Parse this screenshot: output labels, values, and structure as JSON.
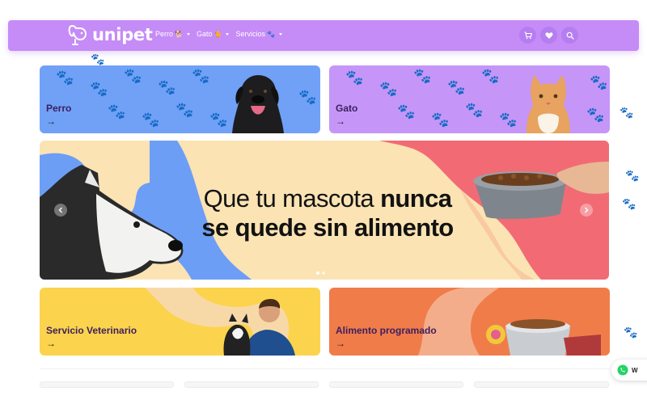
{
  "brand": {
    "name": "unipet"
  },
  "nav": {
    "items": [
      {
        "label": "Perro",
        "emoji": "🐕"
      },
      {
        "label": "Gato",
        "emoji": "🐈"
      },
      {
        "label": "Servicios",
        "emoji": "🐾"
      }
    ],
    "icons": [
      "cart-icon",
      "heart-icon",
      "search-icon"
    ]
  },
  "categories": [
    {
      "label": "Perro",
      "arrow": "→",
      "bg": "#70a1f7"
    },
    {
      "label": "Gato",
      "arrow": "→",
      "bg": "#c596f7"
    },
    {
      "label": "Servicio Veterinario",
      "arrow": "→",
      "bg": "#fcd34d"
    },
    {
      "label": "Alimento programado",
      "arrow": "→",
      "bg": "#f07c4a"
    }
  ],
  "hero": {
    "line1_light": "Que tu mascota",
    "line1_bold": "nunca",
    "line2_bold_a": "se",
    "line2_bold_b": "quede sin alimento",
    "slides": 2,
    "active_slide": 1
  },
  "whatsapp": {
    "label": "W"
  },
  "colors": {
    "nav": "#c58bf7",
    "hero_bg": "#fbe3b3",
    "hero_blue": "#6d9ef5",
    "hero_red": "#f26b74"
  }
}
